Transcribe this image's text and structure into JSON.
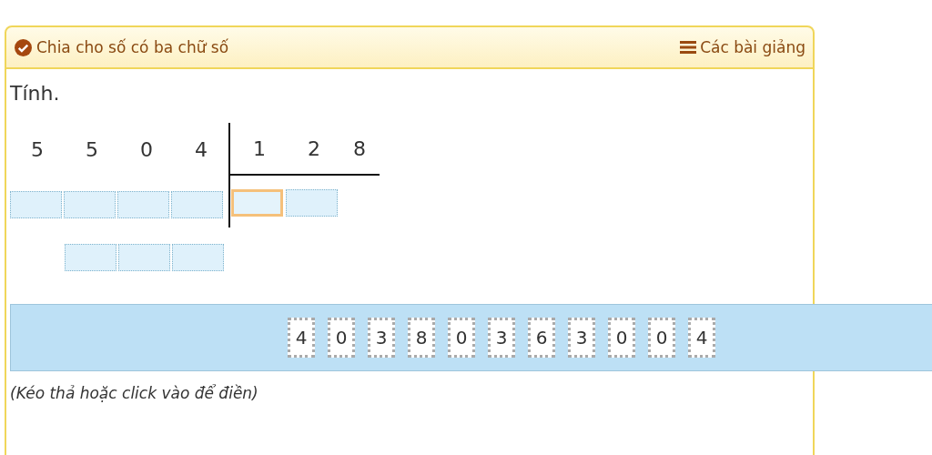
{
  "header": {
    "completed": true,
    "title": "Chia cho số có ba chữ số",
    "lessons_link": "Các bài giảng"
  },
  "prompt": "Tính.",
  "dividend": [
    "5",
    "5",
    "0",
    "4"
  ],
  "divisor": [
    "1",
    "2",
    "8"
  ],
  "remainder_row_1": [
    {
      "kind": "box",
      "selected": false
    },
    {
      "kind": "box",
      "selected": false
    },
    {
      "kind": "box",
      "selected": false
    },
    {
      "kind": "box",
      "selected": false
    }
  ],
  "quotient_boxes": [
    {
      "kind": "box",
      "selected": true
    },
    {
      "kind": "box",
      "selected": false
    }
  ],
  "remainder_row_2": [
    {
      "kind": "gap"
    },
    {
      "kind": "box",
      "selected": false
    },
    {
      "kind": "box",
      "selected": false
    },
    {
      "kind": "box",
      "selected": false
    }
  ],
  "tiles": [
    "4",
    "0",
    "3",
    "8",
    "0",
    "3",
    "6",
    "3",
    "0",
    "0",
    "4"
  ],
  "hint": "(Kéo thả hoặc click vào để điền)"
}
